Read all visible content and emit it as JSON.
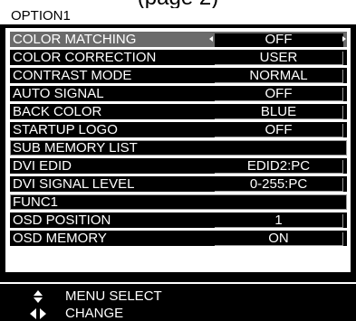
{
  "page_header": {
    "text": "(page 2)"
  },
  "menu_title": "OPTION1",
  "items": [
    {
      "label": "COLOR MATCHING",
      "value": "OFF"
    },
    {
      "label": "COLOR CORRECTION",
      "value": "USER"
    },
    {
      "label": "CONTRAST MODE",
      "value": "NORMAL"
    },
    {
      "label": "AUTO SIGNAL",
      "value": "OFF"
    },
    {
      "label": "BACK COLOR",
      "value": "BLUE"
    },
    {
      "label": "STARTUP LOGO",
      "value": "OFF"
    },
    {
      "label": "SUB MEMORY LIST"
    },
    {
      "label": "DVI EDID",
      "value": "EDID2:PC"
    },
    {
      "label": "DVI SIGNAL LEVEL",
      "value": "0-255:PC"
    },
    {
      "label": "FUNC1"
    },
    {
      "label": "OSD POSITION",
      "value": "1"
    },
    {
      "label": "OSD MEMORY",
      "value": "ON"
    }
  ],
  "guide": {
    "menu_select_icon": "up-down-arrow-icon",
    "menu_select": "MENU SELECT",
    "change_icon": "left-right-arrow-icon",
    "change": "CHANGE"
  },
  "colors": {
    "osd_background": "#000000",
    "panel": "#ffffff",
    "highlight": "#6b6b6b",
    "border": "#9a9a9a"
  }
}
